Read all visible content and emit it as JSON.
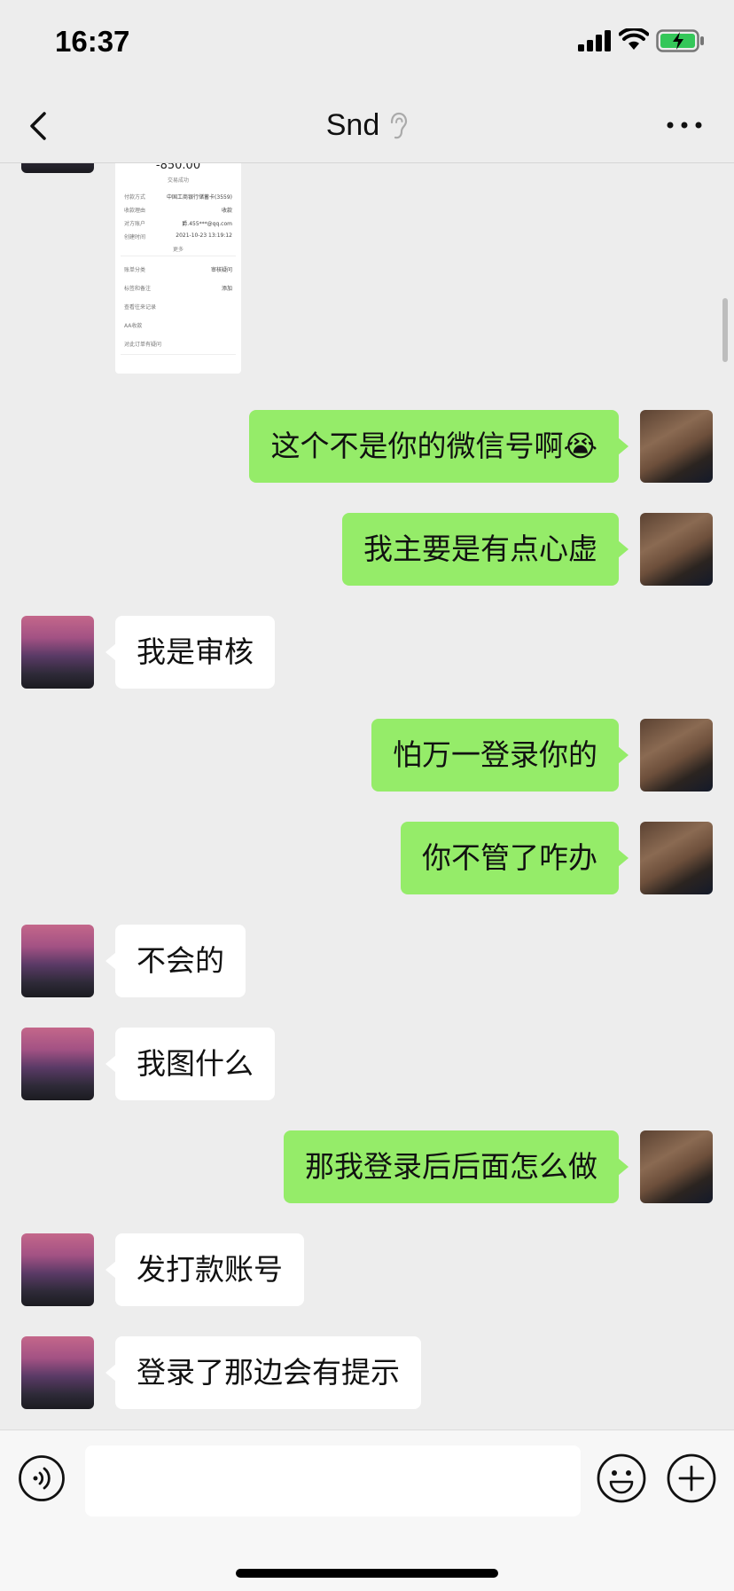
{
  "status_bar": {
    "time": "16:37"
  },
  "header": {
    "title": "Snd"
  },
  "receipt": {
    "amount": "-850.00",
    "status": "交易成功",
    "rows": [
      {
        "k": "付款方式",
        "v": "中国工商银行储蓄卡(3559)"
      },
      {
        "k": "收款理由",
        "v": "收款"
      },
      {
        "k": "对方账户",
        "v": "爵.455***@qq.com"
      },
      {
        "k": "创建时间",
        "v": "2021-10-23 13:19:12"
      }
    ],
    "more": "更多",
    "menu": [
      "账单分类",
      "标签和备注",
      "查看往来记录",
      "AA收款",
      "对此订单有疑问"
    ],
    "menu_values": [
      "审核疑问",
      "添加",
      "",
      "",
      ""
    ]
  },
  "messages": [
    {
      "side": "out",
      "text": "这个不是你的微信号啊😭"
    },
    {
      "side": "out",
      "text": "我主要是有点心虚"
    },
    {
      "side": "in",
      "text": "我是审核"
    },
    {
      "side": "out",
      "text": "怕万一登录你的"
    },
    {
      "side": "out",
      "text": "你不管了咋办"
    },
    {
      "side": "in",
      "text": "不会的"
    },
    {
      "side": "in",
      "text": "我图什么"
    },
    {
      "side": "out",
      "text": "那我登录后后面怎么做"
    },
    {
      "side": "in",
      "text": "发打款账号"
    },
    {
      "side": "in",
      "text": "登录了那边会有提示"
    }
  ],
  "input": {
    "placeholder": ""
  }
}
